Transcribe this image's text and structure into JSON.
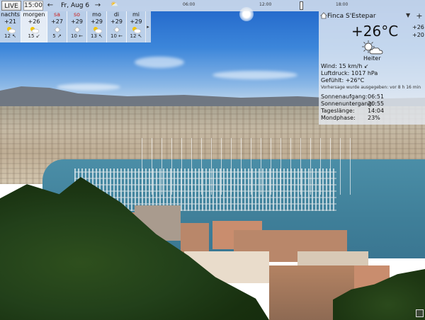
{
  "toolbar": {
    "live_label": "LIVE",
    "time_value": "15:00",
    "prev_icon": "arrow-left-icon",
    "next_icon": "arrow-right-icon",
    "date_label": "Fr, Aug 6",
    "timeline_ticks": [
      "06:00",
      "12:00",
      "18:00"
    ]
  },
  "forecast": {
    "days": [
      {
        "name": "nachts",
        "temp": "+21",
        "icon": "partly-cloudy-icon",
        "wind": "12",
        "weekend": false,
        "selected": false
      },
      {
        "name": "morgen",
        "temp": "+26",
        "icon": "partly-cloudy-icon",
        "wind": "15",
        "weekend": false,
        "selected": true
      },
      {
        "name": "sa",
        "temp": "+27",
        "icon": "sun-icon",
        "wind": "5",
        "weekend": true,
        "selected": false
      },
      {
        "name": "so",
        "temp": "+29",
        "icon": "sun-icon",
        "wind": "10",
        "weekend": true,
        "selected": false
      },
      {
        "name": "mo",
        "temp": "+29",
        "icon": "partly-cloudy-icon",
        "wind": "13",
        "weekend": false,
        "selected": false
      },
      {
        "name": "di",
        "temp": "+29",
        "icon": "sun-icon",
        "wind": "10",
        "weekend": false,
        "selected": false
      },
      {
        "name": "mi",
        "temp": "+29",
        "icon": "partly-cloudy-icon",
        "wind": "12",
        "weekend": false,
        "selected": false
      }
    ],
    "more_icon": "chevron-right-icon"
  },
  "panel": {
    "location": "Finca S'Estepar",
    "current_temp": "+26°C",
    "high": "+26",
    "low": "+20",
    "condition": "Heiter",
    "wind_label": "Wind:",
    "wind_value": "15 km/h",
    "pressure_label": "Luftdruck:",
    "pressure_value": "1017 hPa",
    "feels_label": "Gefühlt:",
    "feels_value": "+26°C",
    "forecast_note": "Vorhersage wurde ausgegeben: vor 8 h 16 min",
    "sunrise_label": "Sonnenaufgang:",
    "sunrise_value": "06:51",
    "sunset_label": "Sonnenuntergang:",
    "sunset_value": "20:55",
    "daylength_label": "Tageslänge:",
    "daylength_value": "14:04",
    "moonphase_label": "Mondphase:",
    "moonphase_value": "23%"
  },
  "colors": {
    "weekend": "#cc2222",
    "panel_bg": "#e6ebf2"
  }
}
